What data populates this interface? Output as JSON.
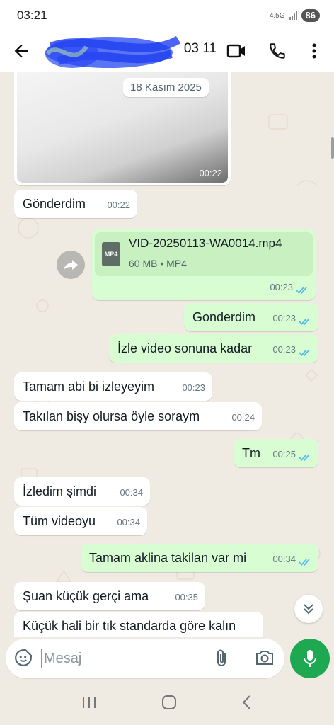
{
  "status_bar": {
    "time": "03:21",
    "network": "4.5G",
    "battery": "86"
  },
  "header": {
    "contact_name_visible": "03 11",
    "icons": [
      "back-arrow-icon",
      "video-call-icon",
      "phone-icon",
      "more-vert-icon"
    ]
  },
  "chat": {
    "date_chip": "18 Kasım 2025",
    "image_message": {
      "time": "00:22"
    },
    "file_message": {
      "filename": "VID-20250113-WA0014.mp4",
      "meta": "60 MB • MP4",
      "badge": "MP4",
      "time": "00:23"
    },
    "messages": [
      {
        "dir": "in",
        "text": "Gönderdim",
        "time": "00:22"
      },
      {
        "dir": "out",
        "text": "Gonderdim",
        "time": "00:23"
      },
      {
        "dir": "out",
        "text": "İzle video sonuna kadar",
        "time": "00:23"
      },
      {
        "dir": "in",
        "text": "Tamam abi bi izleyeyim",
        "time": "00:23"
      },
      {
        "dir": "in",
        "text": "Takılan bişy olursa öyle soraym",
        "time": "00:24"
      },
      {
        "dir": "out",
        "text": "Tm",
        "time": "00:25"
      },
      {
        "dir": "in",
        "text": "İzledim şimdi",
        "time": "00:34"
      },
      {
        "dir": "in",
        "text": "Tüm videoyu",
        "time": "00:34"
      },
      {
        "dir": "out",
        "text": "Tamam aklina takilan var mi",
        "time": "00:34"
      },
      {
        "dir": "in",
        "text": "Şuan küçük gerçi ama",
        "time": "00:35"
      },
      {
        "dir": "in",
        "text": "Küçük hali bir tık standarda göre kalın",
        "time": ""
      }
    ]
  },
  "input": {
    "placeholder": "Mesaj"
  },
  "colors": {
    "chat_bg": "#efeae2",
    "outgoing_bubble": "#d9fdd3",
    "incoming_bubble": "#ffffff",
    "accent_green": "#1da851",
    "read_ticks": "#53bdeb"
  }
}
